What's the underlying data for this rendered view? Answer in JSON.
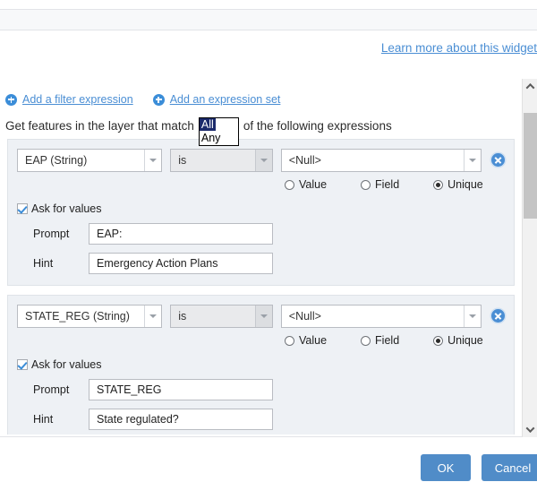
{
  "header": {
    "learn_more_label": "Learn more about this widget"
  },
  "toolbar": {
    "add_filter_label": "Add a filter expression",
    "add_set_label": "Add an expression set"
  },
  "match": {
    "prefix": "Get features in the layer that match",
    "suffix": "of the following expressions",
    "options": [
      "All",
      "Any"
    ],
    "selected": "All"
  },
  "expressions": [
    {
      "field": "EAP (String)",
      "operator": "is",
      "value": "<Null>",
      "value_modes": [
        "Value",
        "Field",
        "Unique"
      ],
      "value_mode_selected": "Unique",
      "ask_for_values_label": "Ask for values",
      "ask_for_values_checked": true,
      "prompt_label": "Prompt",
      "prompt_value": "EAP:",
      "hint_label": "Hint",
      "hint_value": "Emergency Action Plans"
    },
    {
      "field": "STATE_REG (String)",
      "operator": "is",
      "value": "<Null>",
      "value_modes": [
        "Value",
        "Field",
        "Unique"
      ],
      "value_mode_selected": "Unique",
      "ask_for_values_label": "Ask for values",
      "ask_for_values_checked": true,
      "prompt_label": "Prompt",
      "prompt_value": "STATE_REG",
      "hint_label": "Hint",
      "hint_value": "State regulated?"
    }
  ],
  "footer": {
    "ok_label": "OK",
    "cancel_label": "Cancel"
  },
  "colors": {
    "link": "#4a8ed4",
    "accent": "#3b8dd8",
    "button": "#508cc8",
    "panel": "#eef1f5",
    "select_highlight": "#1b2a6b"
  }
}
